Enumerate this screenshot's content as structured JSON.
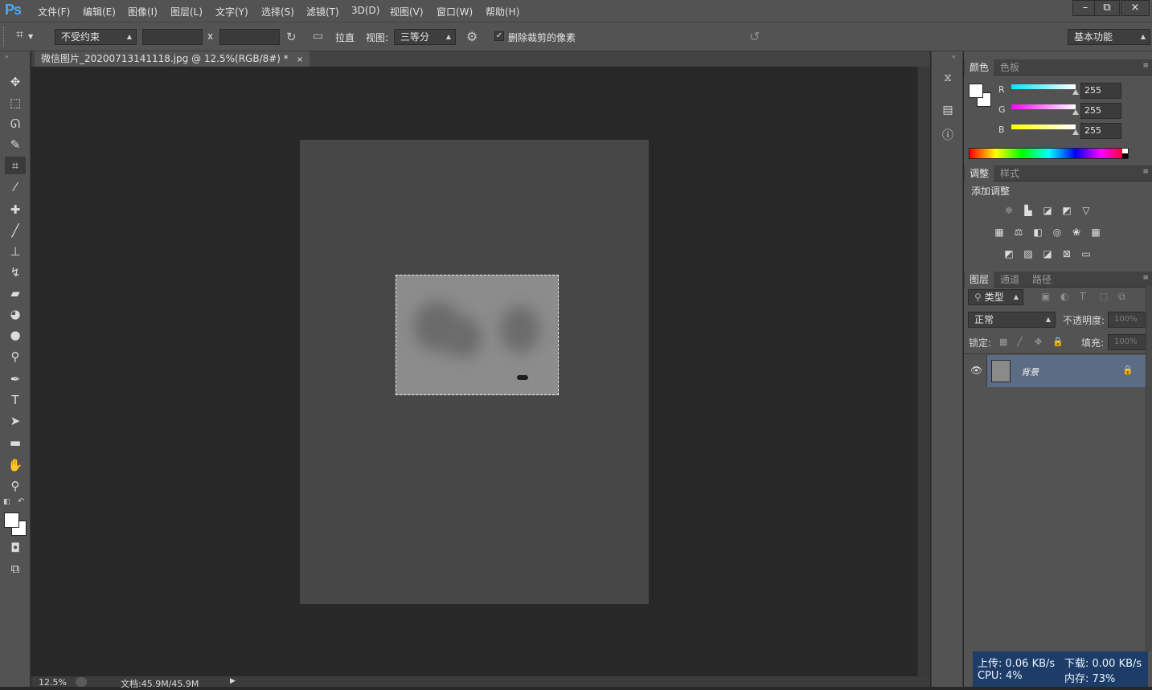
{
  "app": {
    "logo": "Ps"
  },
  "menu": [
    "文件(F)",
    "编辑(E)",
    "图像(I)",
    "图层(L)",
    "文字(Y)",
    "选择(S)",
    "滤镜(T)",
    "3D(D)",
    "视图(V)",
    "窗口(W)",
    "帮助(H)"
  ],
  "window_controls": {
    "minimize": "–",
    "restore": "⧉",
    "close": "×"
  },
  "options": {
    "ratio_value": "不受约束",
    "separator": "x",
    "straighten_label": "拉直",
    "view_label": "视图:",
    "view_value": "三等分",
    "delete_cropped_label": "删除裁剪的像素",
    "delete_cropped_checked": true,
    "workspace_value": "基本功能"
  },
  "document": {
    "tab_title": "微信图片_20200713141118.jpg @ 12.5%(RGB/8#) *",
    "close_symbol": "×"
  },
  "status": {
    "zoom": "12.5%",
    "doc_info": "文档:45.9M/45.9M",
    "arrow": "▶"
  },
  "panels": {
    "color": {
      "tabs": [
        "颜色",
        "色板"
      ],
      "channels": [
        {
          "name": "R",
          "value": "255"
        },
        {
          "name": "G",
          "value": "255"
        },
        {
          "name": "B",
          "value": "255"
        }
      ]
    },
    "adjustments": {
      "tabs": [
        "调整",
        "样式"
      ],
      "title": "添加调整"
    },
    "layers": {
      "tabs": [
        "图层",
        "通道",
        "路径"
      ],
      "filter_label": "类型",
      "blend_mode": "正常",
      "opacity_label": "不透明度:",
      "opacity_value": "100%",
      "lock_label": "锁定:",
      "fill_label": "填充:",
      "fill_value": "100%",
      "items": [
        {
          "name": "背景"
        }
      ]
    }
  },
  "network_monitor": {
    "upload": "上传: 0.06 KB/s",
    "download": "下载: 0.00 KB/s",
    "cpu": "CPU: 4%",
    "memory": "内存: 73%"
  },
  "colors": {
    "accent": "#4aa9ff",
    "workspace": "#282828",
    "panel": "#535353",
    "netmon_bg": "#1d3d68"
  }
}
